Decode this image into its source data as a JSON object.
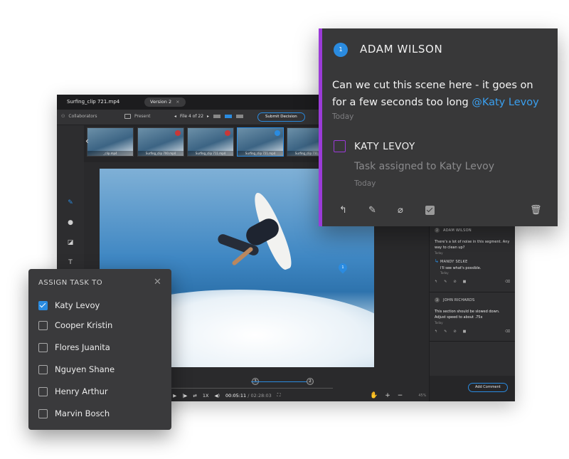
{
  "app": {
    "file_name": "Surfing_clip 721.mp4",
    "version_label": "Version 2",
    "version_close": "×",
    "toolbar": {
      "collaborators": "Collaborators",
      "present": "Present",
      "file_nav": "File 4 of 22",
      "submit": "Submit Decision"
    },
    "thumbnails": [
      {
        "caption": "_clip.mp4"
      },
      {
        "caption": "Surfing_clip 700.mp4"
      },
      {
        "caption": "Surfing_clip 711.mp4"
      },
      {
        "caption": "Surfing_clip 721.mp4"
      },
      {
        "caption": "Surfing_clip 731.mp4"
      }
    ],
    "viewer": {
      "pin_number": "1"
    },
    "timeline": {
      "marker_a": "3",
      "marker_b": "2",
      "speed": "1X",
      "current_time": "00:05:11",
      "separator": " / ",
      "duration": "02:28:03",
      "zoom": "45%"
    },
    "comments": [
      {
        "num": "2",
        "author": "ADAM WILSON",
        "text": "There's a lot of noise in this segment. Any way to clean up?",
        "date": "Today",
        "reply": {
          "author": "MANDY SELKE",
          "text": "I'll see what's possible.",
          "date": "Today"
        }
      },
      {
        "num": "3",
        "author": "JOHN RICHARDS",
        "text": "This section should be slowed down. Adjust speed to about .75x",
        "date": "Today"
      }
    ],
    "add_comment": "Add Comment"
  },
  "assign": {
    "title": "ASSIGN TASK TO",
    "close_icon": "close-icon",
    "people": [
      {
        "name": "Katy Levoy",
        "checked": true
      },
      {
        "name": "Cooper Kristin",
        "checked": false
      },
      {
        "name": "Flores Juanita",
        "checked": false
      },
      {
        "name": "Nguyen Shane",
        "checked": false
      },
      {
        "name": "Henry Arthur",
        "checked": false
      },
      {
        "name": "Marvin Bosch",
        "checked": false
      }
    ]
  },
  "card": {
    "number": "1",
    "author": "ADAM WILSON",
    "body": "Can we cut this scene here - it goes on for a few seconds too long ",
    "mention": "@Katy Levoy",
    "date": "Today",
    "task_assignee": "KATY LEVOY",
    "task_text": "Task assigned to Katy Levoy",
    "task_date": "Today",
    "accent_color": "#9b3bd8",
    "icons": [
      "reply-icon",
      "pencil-icon",
      "paperclip-icon",
      "approve-checkbox-icon",
      "trash-icon"
    ]
  },
  "colors": {
    "accent_blue": "#2a8be0",
    "accent_purple": "#9b3bd8",
    "panel_dark": "#2a2a2c"
  }
}
